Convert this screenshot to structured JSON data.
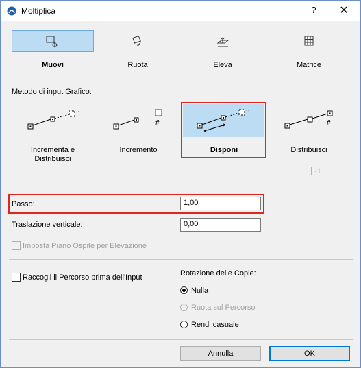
{
  "window": {
    "title": "Moltiplica",
    "help_label": "?",
    "close_label": "✕"
  },
  "tabs": [
    {
      "label": "Muovi",
      "icon": "move-icon",
      "selected": true
    },
    {
      "label": "Ruota",
      "icon": "rotate-icon",
      "selected": false
    },
    {
      "label": "Eleva",
      "icon": "elevate-icon",
      "selected": false
    },
    {
      "label": "Matrice",
      "icon": "matrix-icon",
      "selected": false
    }
  ],
  "input_method": {
    "heading": "Metodo di input Grafico:",
    "options": [
      {
        "label": "Incrementa e\nDistribuisci",
        "selected": false
      },
      {
        "label": "Incremento",
        "selected": false,
        "symbol": "#"
      },
      {
        "label": "Disponi",
        "selected": true
      },
      {
        "label": "Distribuisci",
        "selected": false,
        "symbol": "#"
      }
    ],
    "minus_one": {
      "label": "-1",
      "checked": false,
      "enabled": false
    }
  },
  "fields": {
    "passo": {
      "label": "Passo:",
      "value": "1,00"
    },
    "traslazione": {
      "label": "Traslazione verticale:",
      "value": "0,00"
    }
  },
  "imposta_piano": {
    "label": "Imposta Piano Ospite per Elevazione",
    "checked": false,
    "enabled": false
  },
  "raccogli": {
    "label": "Raccogli il Percorso prima dell'Input",
    "checked": false
  },
  "rotazione": {
    "heading": "Rotazione delle Copie:",
    "options": [
      {
        "label": "Nulla",
        "checked": true,
        "enabled": true
      },
      {
        "label": "Ruota sul Percorso",
        "checked": false,
        "enabled": false
      },
      {
        "label": "Rendi casuale",
        "checked": false,
        "enabled": true
      }
    ]
  },
  "buttons": {
    "cancel": "Annulla",
    "ok": "OK"
  },
  "colors": {
    "selection": "#bcdcf4",
    "highlight": "#e0241f",
    "default_button": "#0078d7"
  }
}
